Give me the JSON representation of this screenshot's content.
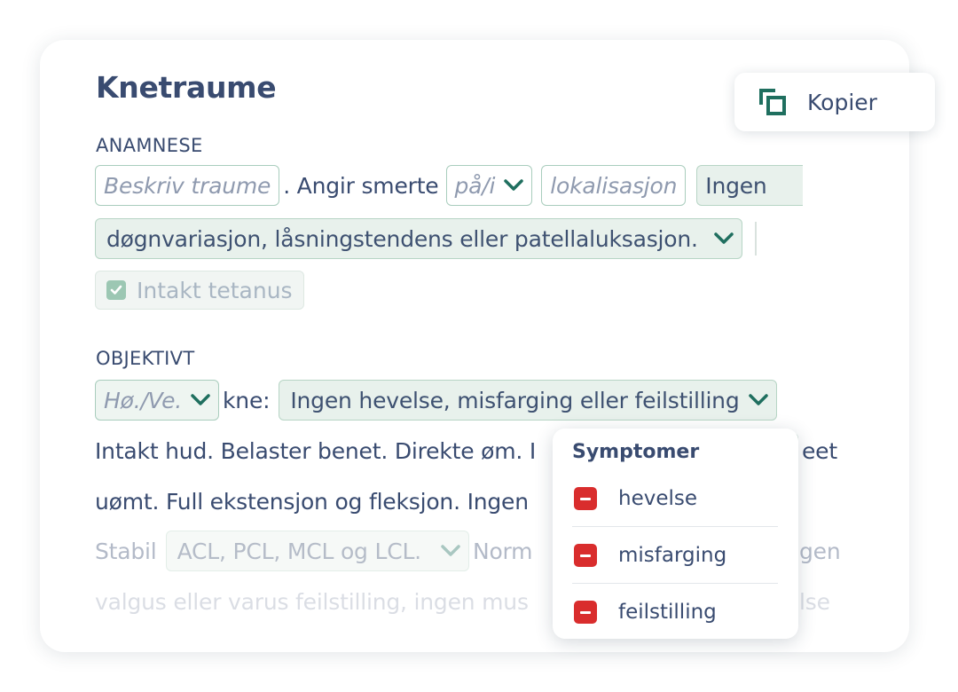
{
  "card": {
    "title": "Knetraume",
    "anamnese": {
      "label": "ANAMNESE",
      "traume_placeholder": "Beskriv traume",
      "text_after_traume": ". Angir smerte",
      "paa_select": "på/i",
      "lokalisasjon_placeholder": "lokalisasjon",
      "ingen_select_line1": "Ingen",
      "ingen_select_line2": "døgnvariasjon, låsningstendens eller patellaluksasjon.",
      "tetanus_checkbox": "Intakt tetanus",
      "tetanus_checked": true
    },
    "objektivt": {
      "label": "OBJEKTIVT",
      "side_select": "Hø./Ve.",
      "text_kne": "kne:",
      "findings_select": "Ingen hevelse, misfarging eller feilstilling",
      "line_a_left": "Intakt hud. Belaster benet. Direkte øm. I",
      "line_a_right": "eet",
      "line_b_left": "uømt. Full ekstensjon og fleksjon. Ingen",
      "line_c_left": "Stabil",
      "ligament_select": "ACL, PCL, MCL og LCL.",
      "line_c_mid": "Norm",
      "line_c_right": "gen",
      "line_d_left": "valgus eller varus feilstilling, ingen mus",
      "line_d_right": "lse"
    }
  },
  "copy_button": {
    "label": "Kopier",
    "icon": "copy-icon"
  },
  "symptom_popup": {
    "title": "Symptomer",
    "items": [
      {
        "label": "hevelse",
        "icon": "minus-icon"
      },
      {
        "label": "misfarging",
        "icon": "minus-icon"
      },
      {
        "label": "feilstilling",
        "icon": "minus-icon"
      }
    ]
  },
  "colors": {
    "text": "#394b70",
    "chip_fill": "#e8f1ec",
    "chip_border": "#b7d5c5",
    "accent_teal": "#1f6f5f",
    "remove_red": "#d92d2d"
  }
}
